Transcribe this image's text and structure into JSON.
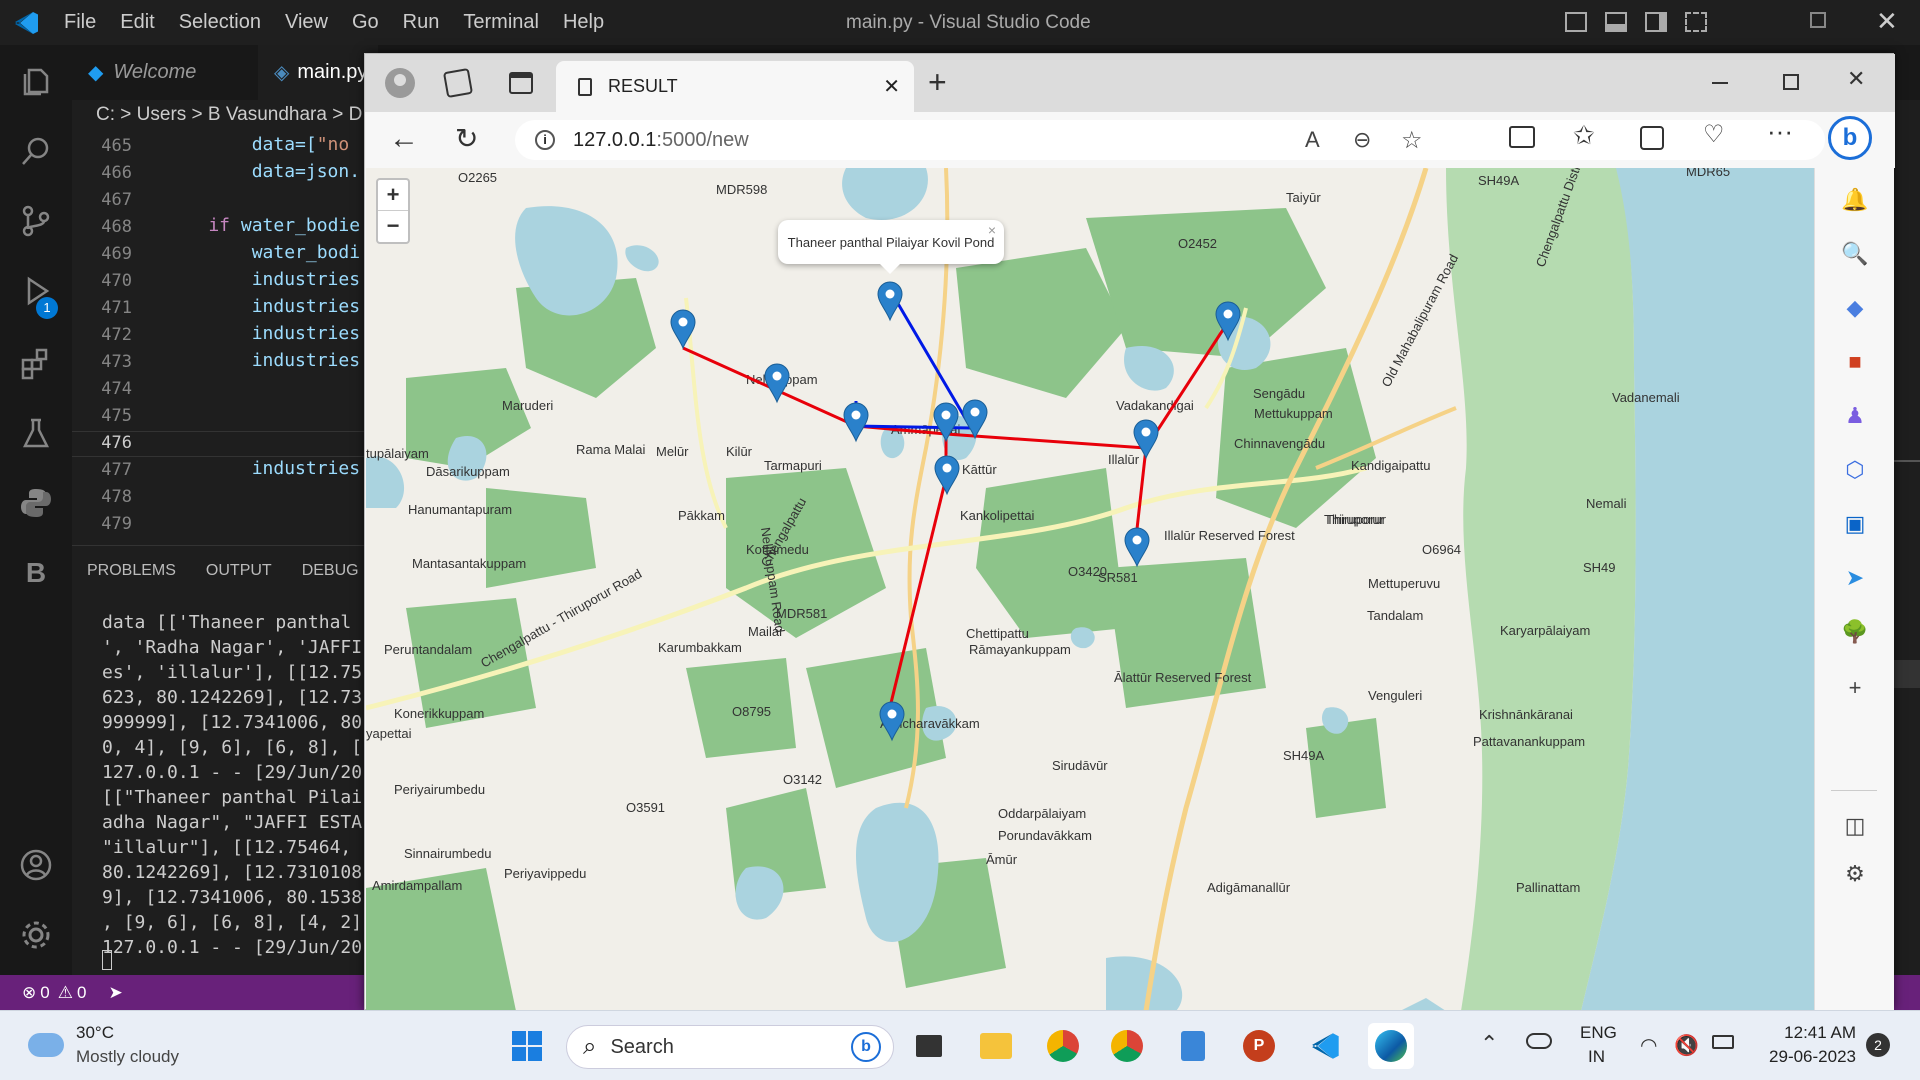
{
  "vscode": {
    "title": "main.py - Visual Studio Code",
    "menu": [
      "File",
      "Edit",
      "Selection",
      "View",
      "Go",
      "Run",
      "Terminal",
      "Help"
    ],
    "tabs": [
      {
        "label": "Welcome"
      },
      {
        "label": "main.py"
      }
    ],
    "breadcrumb": "C: > Users > B Vasundhara > D",
    "line_numbers": [
      "465",
      "466",
      "467",
      "468",
      "469",
      "470",
      "471",
      "472",
      "473",
      "474",
      "475",
      "476",
      "477",
      "478",
      "479"
    ],
    "code_lines": [
      {
        "text": "        data=[\"no",
        "l": 1
      },
      {
        "text": "        data=json.",
        "l": 2
      },
      {
        "text": "",
        "l": 3
      },
      {
        "text": "    if water_bodie",
        "l": 4
      },
      {
        "text": "        water_bodi",
        "l": 5
      },
      {
        "text": "        industries",
        "l": 6
      },
      {
        "text": "        industries",
        "l": 7
      },
      {
        "text": "        industries",
        "l": 8
      },
      {
        "text": "        industries",
        "l": 9
      },
      {
        "text": "",
        "l": 10
      },
      {
        "text": "",
        "l": 11
      },
      {
        "text": "",
        "l": 12
      },
      {
        "text": "        industries",
        "l": 13
      },
      {
        "text": "",
        "l": 14
      },
      {
        "text": "",
        "l": 15
      }
    ],
    "panel_tabs": [
      "PROBLEMS",
      "OUTPUT",
      "DEBUG"
    ],
    "terminal_lines": [
      "data [['Thaneer panthal",
      "', 'Radha Nagar', 'JAFFI",
      "es', 'illalur'], [[12.75",
      "623, 80.1242269], [12.73",
      "999999], [12.7341006, 80",
      "0, 4], [9, 6], [6, 8], [",
      "127.0.0.1 - - [29/Jun/20",
      "[[\"Thaneer panthal Pilai",
      "adha Nagar\", \"JAFFI ESTA",
      "\"illalur\"], [[12.75464,",
      "80.1242269], [12.7310108",
      "9], [12.7341006, 80.1538",
      ", [9, 6], [6, 8], [4, 2]",
      "127.0.0.1 - - [29/Jun/20"
    ],
    "status": {
      "errors": "0",
      "warnings": "0"
    },
    "debug_badge": "1"
  },
  "browser": {
    "tab_title": "RESULT",
    "url_host": "127.0.0.1",
    "url_rest": ":5000/new",
    "popup_text": "Thaneer panthal Pilaiyar Kovil Pond",
    "zoom_in": "+",
    "zoom_out": "−"
  },
  "map_labels": [
    "O2265",
    "MDR598",
    "O2452",
    "SH49A",
    "MDR65",
    "Taiyūr",
    "Nellikuppam",
    "Maruderi",
    "Ammāpettai",
    "Vadakandigai",
    "Sengādu",
    "Mettukuppam",
    "Vadanemali",
    "Kilūr",
    "Rama Malai",
    "Melūr",
    "Kāttūr",
    "Illalūr",
    "Chinnavengādu",
    "Kandigaipattu",
    "Dāsarikuppam",
    "Tarmapuri",
    "Thiruporur",
    "Hanumantapuram",
    "Pākkam",
    "Kankolipettai",
    "Illalūr Reserved Forest",
    "Nemali",
    "Kottamedu",
    "O6964",
    "SH49",
    "Mantasantakuppam",
    "O3420",
    "SR581",
    "Mettuperuvu",
    "MDR581",
    "Tandalam",
    "Mailai",
    "Chettipattu",
    "Rāmayankuppam",
    "Karumbakkam",
    "Peruntandalam",
    "Karyarpālaiyam",
    "Ālattūr Reserved Forest",
    "Konerikkuppam",
    "O8795",
    "Venguleri",
    "Krishnānkāranai",
    "Achcharavākkam",
    "Pattavanankuppam",
    "Sirudāvūr",
    "SH49A",
    "O3142",
    "Periyairumbedu",
    "O3591",
    "Oddarpālaiyam",
    "Porundavākkam",
    "Sinnairumbedu",
    "Āmūr",
    "Periyavippedu",
    "Amirdampallam",
    "Adigāmanallūr",
    "Pallinattam",
    "Old Mahabalipuram Road",
    "Chengalpattu - Thiruporur Road",
    "Nellikuppam Road",
    "Chengalpattu District",
    "Thiruporur",
    "tupālaiyam",
    "yapettai",
    "Chengalpattu"
  ],
  "taskbar": {
    "weather_temp": "30°C",
    "weather_desc": "Mostly cloudy",
    "search_placeholder": "Search",
    "lang_1": "ENG",
    "lang_2": "IN",
    "time": "12:41 AM",
    "date": "29-06-2023",
    "notif_count": "2"
  },
  "colors": {
    "route_red": "#e8000a",
    "route_blue": "#0019e6",
    "marker": "#2a81cb",
    "water": "#aad3df",
    "forest": "#8dc48a",
    "sea": "#aad3df",
    "statusbar": "#68217a"
  }
}
